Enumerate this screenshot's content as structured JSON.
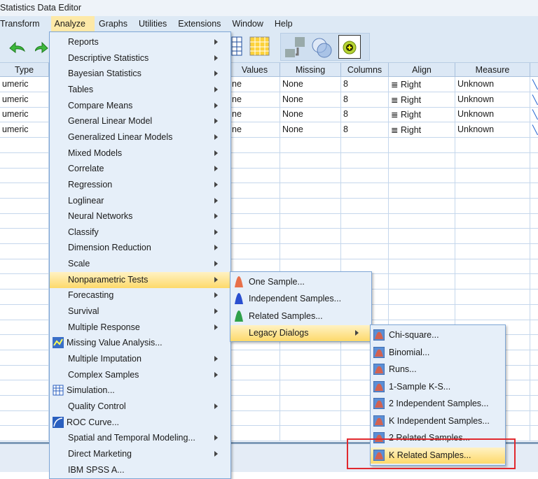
{
  "window": {
    "title": "Statistics Data Editor"
  },
  "menubar": [
    {
      "label": "Transform"
    },
    {
      "label": "Analyze",
      "active": true
    },
    {
      "label": "Graphs"
    },
    {
      "label": "Utilities"
    },
    {
      "label": "Extensions"
    },
    {
      "label": "Window"
    },
    {
      "label": "Help"
    }
  ],
  "grid": {
    "headers": [
      "Type",
      "Values",
      "Missing",
      "Columns",
      "Align",
      "Measure"
    ],
    "rows": [
      {
        "type": "umeric",
        "values": "ne",
        "missing": "None",
        "columns": "8",
        "align": "Right",
        "measure": "Unknown"
      },
      {
        "type": "umeric",
        "values": "ne",
        "missing": "None",
        "columns": "8",
        "align": "Right",
        "measure": "Unknown"
      },
      {
        "type": "umeric",
        "values": "ne",
        "missing": "None",
        "columns": "8",
        "align": "Right",
        "measure": "Unknown"
      },
      {
        "type": "umeric",
        "values": "ne",
        "missing": "None",
        "columns": "8",
        "align": "Right",
        "measure": "Unknown"
      }
    ]
  },
  "analyze_menu": [
    {
      "label": "Reports",
      "submenu": true
    },
    {
      "label": "Descriptive Statistics",
      "submenu": true
    },
    {
      "label": "Bayesian Statistics",
      "submenu": true
    },
    {
      "label": "Tables",
      "submenu": true
    },
    {
      "label": "Compare Means",
      "submenu": true
    },
    {
      "label": "General Linear Model",
      "submenu": true
    },
    {
      "label": "Generalized Linear Models",
      "submenu": true
    },
    {
      "label": "Mixed Models",
      "submenu": true
    },
    {
      "label": "Correlate",
      "submenu": true
    },
    {
      "label": "Regression",
      "submenu": true
    },
    {
      "label": "Loglinear",
      "submenu": true
    },
    {
      "label": "Neural Networks",
      "submenu": true
    },
    {
      "label": "Classify",
      "submenu": true
    },
    {
      "label": "Dimension Reduction",
      "submenu": true
    },
    {
      "label": "Scale",
      "submenu": true
    },
    {
      "label": "Nonparametric Tests",
      "submenu": true,
      "highlighted": true
    },
    {
      "label": "Forecasting",
      "submenu": true
    },
    {
      "label": "Survival",
      "submenu": true
    },
    {
      "label": "Multiple Response",
      "submenu": true
    },
    {
      "label": "Missing Value Analysis...",
      "icon": "missing-value-icon"
    },
    {
      "label": "Multiple Imputation",
      "submenu": true
    },
    {
      "label": "Complex Samples",
      "submenu": true
    },
    {
      "label": "Simulation...",
      "icon": "simulation-icon"
    },
    {
      "label": "Quality Control",
      "submenu": true
    },
    {
      "label": "ROC Curve...",
      "icon": "roc-curve-icon"
    },
    {
      "label": "Spatial and Temporal Modeling...",
      "submenu": true
    },
    {
      "label": "Direct Marketing",
      "submenu": true
    },
    {
      "label": "IBM SPSS A..."
    }
  ],
  "nonparametric_menu": [
    {
      "label": "One Sample...",
      "icon": "one-sample-icon",
      "color": "#e8704a"
    },
    {
      "label": "Independent Samples...",
      "icon": "independent-samples-icon",
      "color": "#2a4fd0"
    },
    {
      "label": "Related Samples...",
      "icon": "related-samples-icon",
      "color": "#2fa04a"
    },
    {
      "label": "Legacy Dialogs",
      "submenu": true,
      "highlighted": true
    }
  ],
  "legacy_menu": [
    {
      "label": "Chi-square...",
      "icon": "chi-square-icon"
    },
    {
      "label": "Binomial...",
      "icon": "binomial-icon"
    },
    {
      "label": "Runs...",
      "icon": "runs-icon"
    },
    {
      "label": "1-Sample K-S...",
      "icon": "one-sample-ks-icon"
    },
    {
      "label": "2 Independent Samples...",
      "icon": "two-independent-samples-icon"
    },
    {
      "label": "K Independent Samples...",
      "icon": "k-independent-samples-icon"
    },
    {
      "label": "2 Related Samples...",
      "icon": "two-related-samples-icon"
    },
    {
      "label": "K Related Samples...",
      "icon": "k-related-samples-icon",
      "highlighted": true
    }
  ],
  "colors": {
    "highlight": "#fdd96a",
    "menu_bg": "#e6eff9",
    "annotation": "#e0282e"
  }
}
